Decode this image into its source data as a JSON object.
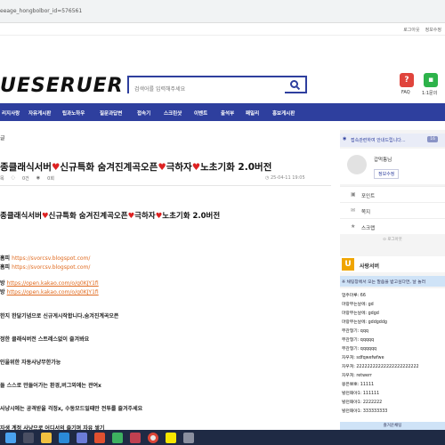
{
  "browser": {
    "url": "eeage_hongbolbor_id=576561"
  },
  "topstrip": {
    "links": [
      "로그아웃",
      "정보수정"
    ]
  },
  "header": {
    "logo": "UESERUER",
    "search_placeholder": "검색어를 입력해주세요",
    "faq_label": "FAQ",
    "faq_icon_text": "?",
    "support_label": "1:1문의",
    "colors": {
      "faq": "#e0443c",
      "support": "#2db34a",
      "nav": "#2e3f9e"
    }
  },
  "nav": {
    "items": [
      "리지사랑",
      "자유게시판",
      "팁과노하우",
      "질문과답변",
      "접속기",
      "스크린샷",
      "이벤트",
      "출석부",
      "패밀리",
      "홍보게시판"
    ]
  },
  "post": {
    "breadcrumb": "글",
    "title": "종클래식서버",
    "title_parts": [
      "종클래식서버",
      "신규특화 숨겨진계곡오픈",
      "극하자",
      "노초기화 2.0버전"
    ],
    "meta": [
      "목",
      "0건",
      "0회"
    ],
    "date": "25-04-11 19:05",
    "body_title_parts": [
      "종클래식서버",
      "신규특화 숨겨진계곡오픈",
      "극하자",
      "노초기화 2.0버전"
    ],
    "homepage_label1": "홈피",
    "homepage_label2": "홈피",
    "homepage_url": "https://svorcsv.blogspot.com/",
    "kakao_label1": "방",
    "kakao_label2": "방",
    "kakao_url": "https://open.kakao.com/o/g0KJY1fi",
    "lines": [
      "한지 한달기념으로 신규게시작합니다.숨겨진계곡오픈",
      "정한 클래식버전 스트레스없이 즐겨봐요",
      "인을위한 자동사냥무한가능",
      "들 스스로 만들어가는 환경,버그외에는 관여x",
      "사냥시에는 공격받을 걱정x, 수동모드일때만 전투를 즐겨주세요",
      "자생 계정 사냥으로 어디서의 즐기며 자유 쌓기"
    ]
  },
  "sidebar": {
    "notice": "접속관련하여 안내드립니다...",
    "notice_badge": "16",
    "profile_name": "갑먹퉁님",
    "profile_link": "정보수정",
    "rows": [
      {
        "icon": "▣",
        "label": "포인트"
      },
      {
        "icon": "✉",
        "label": "쪽지"
      },
      {
        "icon": "★",
        "label": "스크랩"
      }
    ],
    "logout": "로그아웃"
  },
  "chat": {
    "title": "사랑서버",
    "logo_text": "U",
    "banner": "※ 채팅창에서 모는 말씀을 받고싶다면, 날 놀러",
    "messages": [
      "업주마루: 66",
      "마랑부는날에: gd",
      "마랑부는날에: gdgd",
      "마랑부는날에: gddgddg",
      "부관형기: qqq",
      "부관형기: qqqqq",
      "부관형기: qqqqqq",
      "자우쳐: sdfqwefwfwe",
      "자우쳐: 22222222222222222222222",
      "자우쳐: retwerr",
      "몽은뽀뽀: 11111",
      "빌런패야1: 111111",
      "빌런패야1: 2222222",
      "빌런패야1: 333333333"
    ],
    "footer": "즐거운채팅"
  },
  "taskbar": {
    "icons": [
      "windows-icon",
      "search-icon",
      "explorer-icon",
      "edge-icon",
      "store-icon",
      "app-icon",
      "app2-icon",
      "app3-icon",
      "chrome-icon",
      "kakao-icon",
      "app4-icon"
    ]
  }
}
